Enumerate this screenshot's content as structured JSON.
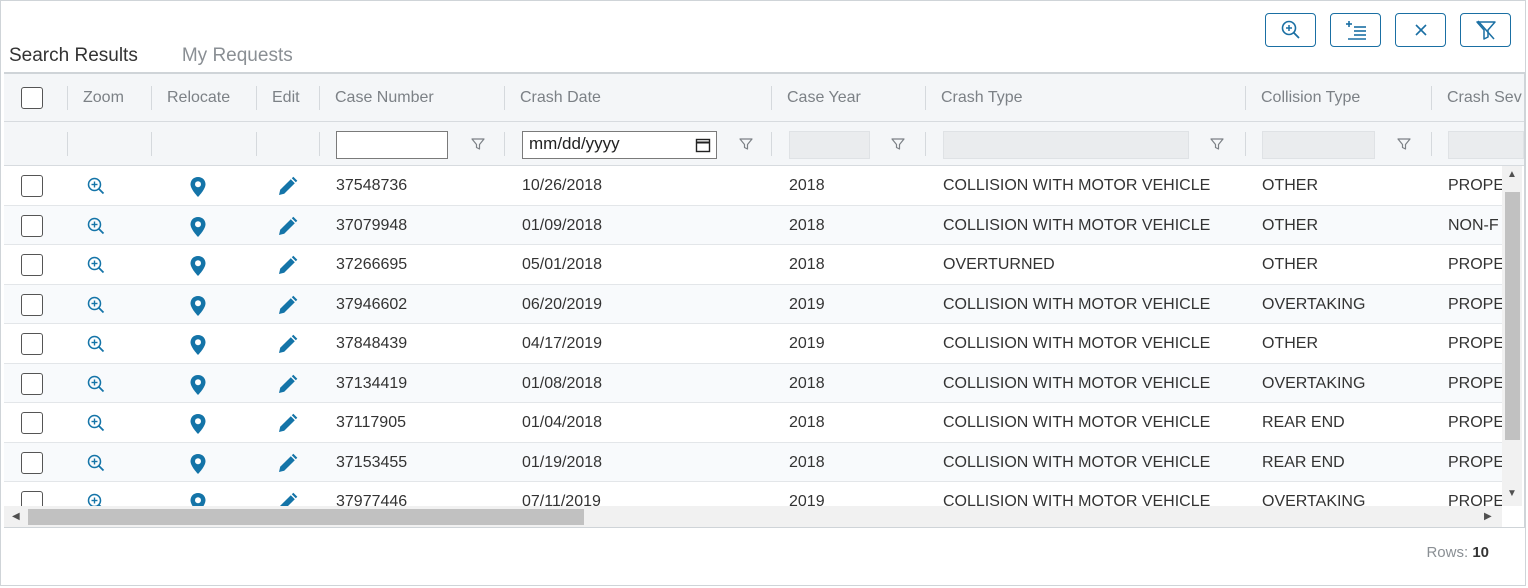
{
  "toolbar": {
    "buttons": [
      {
        "icon": "zoom-in-icon"
      },
      {
        "icon": "column-chooser-icon"
      },
      {
        "icon": "close-icon"
      },
      {
        "icon": "clear-filter-icon"
      }
    ]
  },
  "tabs": [
    {
      "label": "Search Results",
      "active": true
    },
    {
      "label": "My Requests",
      "active": false
    }
  ],
  "columns": {
    "zoom": "Zoom",
    "relocate": "Relocate",
    "edit": "Edit",
    "case_number": "Case Number",
    "crash_date": "Crash Date",
    "case_year": "Case Year",
    "crash_type": "Crash Type",
    "collision_type": "Collision Type",
    "crash_severity": "Crash Sev"
  },
  "filters": {
    "case_number": "",
    "crash_date": "mm/dd/yyyy"
  },
  "rows": [
    {
      "case_number": "37548736",
      "crash_date": "10/26/2018",
      "case_year": "2018",
      "crash_type": "COLLISION WITH MOTOR VEHICLE",
      "collision_type": "OTHER",
      "crash_severity": "PROPE"
    },
    {
      "case_number": "37079948",
      "crash_date": "01/09/2018",
      "case_year": "2018",
      "crash_type": "COLLISION WITH MOTOR VEHICLE",
      "collision_type": "OTHER",
      "crash_severity": "NON-F"
    },
    {
      "case_number": "37266695",
      "crash_date": "05/01/2018",
      "case_year": "2018",
      "crash_type": "OVERTURNED",
      "collision_type": "OTHER",
      "crash_severity": "PROPE"
    },
    {
      "case_number": "37946602",
      "crash_date": "06/20/2019",
      "case_year": "2019",
      "crash_type": "COLLISION WITH MOTOR VEHICLE",
      "collision_type": "OVERTAKING",
      "crash_severity": "PROPE"
    },
    {
      "case_number": "37848439",
      "crash_date": "04/17/2019",
      "case_year": "2019",
      "crash_type": "COLLISION WITH MOTOR VEHICLE",
      "collision_type": "OTHER",
      "crash_severity": "PROPE"
    },
    {
      "case_number": "37134419",
      "crash_date": "01/08/2018",
      "case_year": "2018",
      "crash_type": "COLLISION WITH MOTOR VEHICLE",
      "collision_type": "OVERTAKING",
      "crash_severity": "PROPE"
    },
    {
      "case_number": "37117905",
      "crash_date": "01/04/2018",
      "case_year": "2018",
      "crash_type": "COLLISION WITH MOTOR VEHICLE",
      "collision_type": "REAR END",
      "crash_severity": "PROPE"
    },
    {
      "case_number": "37153455",
      "crash_date": "01/19/2018",
      "case_year": "2018",
      "crash_type": "COLLISION WITH MOTOR VEHICLE",
      "collision_type": "REAR END",
      "crash_severity": "PROPE"
    },
    {
      "case_number": "37977446",
      "crash_date": "07/11/2019",
      "case_year": "2019",
      "crash_type": "COLLISION WITH MOTOR VEHICLE",
      "collision_type": "OVERTAKING",
      "crash_severity": "PROPE"
    }
  ],
  "footer": {
    "rows_label": "Rows:",
    "rows_count": "10"
  },
  "colors": {
    "accent": "#1a6fa3",
    "icon": "#1474a8"
  }
}
